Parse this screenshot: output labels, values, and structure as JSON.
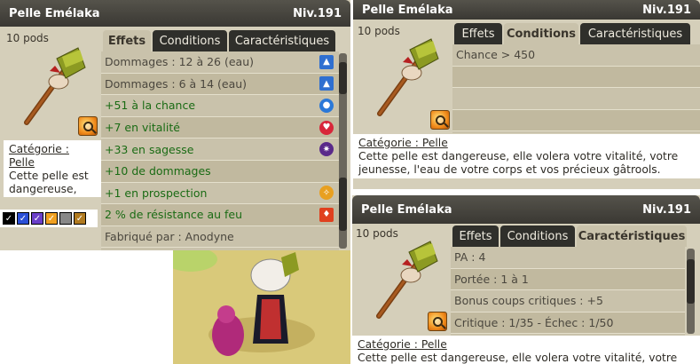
{
  "panel_effects": {
    "title": "Pelle Emélaka",
    "level": "Niv.191",
    "pods": "10 pods",
    "tabs": [
      "Effets",
      "Conditions",
      "Caractéristiques"
    ],
    "rows": [
      {
        "text": "Dommages : 12 à 26 (eau)",
        "icon": "water-damage-icon",
        "color": "grey"
      },
      {
        "text": "Dommages : 6 à 14 (eau)",
        "icon": "water-damage-icon",
        "color": "grey"
      },
      {
        "text": "+51 à la chance",
        "icon": "chance-icon",
        "color": "green"
      },
      {
        "text": "+7 en vitalité",
        "icon": "heart-icon",
        "color": "green"
      },
      {
        "text": "+33 en sagesse",
        "icon": "wisdom-icon",
        "color": "green"
      },
      {
        "text": "+10 de dommages",
        "icon": "",
        "color": "green"
      },
      {
        "text": "+1 en prospection",
        "icon": "prospection-icon",
        "color": "green"
      },
      {
        "text": "2 % de résistance au feu",
        "icon": "fire-icon",
        "color": "green"
      },
      {
        "text": "Fabriqué par : Anodyne",
        "icon": "",
        "color": "grey"
      }
    ],
    "category": "Catégorie : Pelle",
    "description": "Cette pelle est dangereuse, elle volera votre vitalité, votre jeunesse, l'eau de votre corps et vos précieux gâtrools."
  },
  "panel_conditions": {
    "title": "Pelle Emélaka",
    "level": "Niv.191",
    "pods": "10 pods",
    "tabs": [
      "Effets",
      "Conditions",
      "Caractéristiques"
    ],
    "rows": [
      "Chance > 450",
      "",
      "",
      ""
    ],
    "category": "Catégorie : Pelle",
    "description": "Cette pelle est dangereuse, elle volera votre vitalité, votre jeunesse, l'eau de votre corps et vos précieux gâtrools."
  },
  "panel_caracs": {
    "title": "Pelle Emélaka",
    "level": "Niv.191",
    "pods": "10 pods",
    "tabs": [
      "Effets",
      "Conditions",
      "Caractéristiques"
    ],
    "rows": [
      "PA : 4",
      "Portée : 1 à 1",
      "Bonus coups critiques : +5",
      "Critique : 1/35 - Échec : 1/50"
    ],
    "category": "Catégorie : Pelle",
    "description": "Cette pelle est dangereuse, elle volera votre vitalité, votre"
  },
  "swatches": {
    "colors": [
      "#000000",
      "#2b4fd6",
      "#6a3fc9",
      "#f0a020",
      "#888888",
      "#b07a20"
    ]
  },
  "colors": {
    "panel_bg": "#d5cfba",
    "titlebar": "#3a3833",
    "tab_inactive": "#2f2f2b",
    "bonus_text": "#1a6b14"
  }
}
